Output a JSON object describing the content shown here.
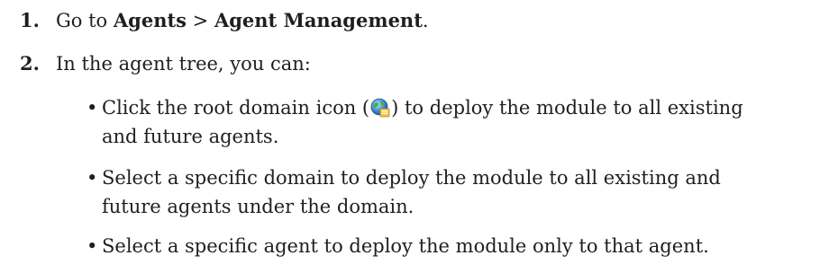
{
  "steps": [
    {
      "number": "1.",
      "prefix": "Go to ",
      "menu_agents": "Agents",
      "separator": " > ",
      "menu_agent_management": "Agent Management",
      "suffix": "."
    },
    {
      "number": "2.",
      "text": "In the agent tree, you can:"
    }
  ],
  "bullets": [
    {
      "dot": "•",
      "before_icon": "Click the root domain icon (",
      "icon": "root-domain-icon",
      "after_icon_line1": ") to deploy the module to all existing",
      "line2": "and future agents."
    },
    {
      "dot": "•",
      "line1": "Select a specific domain to deploy the module to all existing and",
      "line2": "future agents under the domain."
    },
    {
      "dot": "•",
      "line1": "Select a specific agent to deploy the module only to that agent."
    }
  ]
}
